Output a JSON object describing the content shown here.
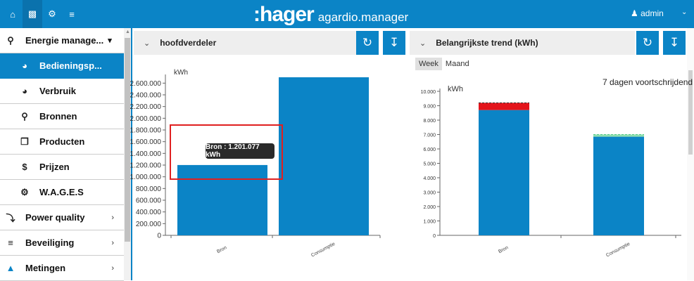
{
  "topbar": {
    "nav_icons": [
      "home-icon",
      "laptop-icon",
      "cogs-icon",
      "sliders-icon"
    ],
    "brand_logo": ":hager",
    "app_name": "agardio.manager",
    "user_icon": "user-icon",
    "user_name": "admin",
    "user_menu_icon": "chevron-down-icon"
  },
  "sidebar": {
    "items": [
      {
        "label": "Energie manage...",
        "icon": "lightbulb-icon",
        "chevron": "▾"
      },
      {
        "label": "Bedieningsp...",
        "icon": "pie-chart-icon"
      },
      {
        "label": "Verbruik",
        "icon": "gauge-icon"
      },
      {
        "label": "Bronnen",
        "icon": "lightbulb-icon"
      },
      {
        "label": "Producten",
        "icon": "cube-icon"
      },
      {
        "label": "Prijzen",
        "icon": "dollar-icon"
      },
      {
        "label": "W.A.G.E.S",
        "icon": "cogs-icon"
      },
      {
        "label": "Power quality",
        "icon": "plug-icon",
        "chevron": "›"
      },
      {
        "label": "Beveiliging",
        "icon": "sliders-icon",
        "chevron": "›"
      },
      {
        "label": "Metingen",
        "icon": "area-chart-icon",
        "chevron": "›"
      }
    ]
  },
  "left_panel": {
    "title": "hoofdverdeler",
    "refresh_icon": "refresh-icon",
    "export_icon": "download-icon",
    "tooltip": "Bron : 1.201.077 kWh"
  },
  "right_panel": {
    "title": "Belangrijkste trend (kWh)",
    "refresh_icon": "refresh-icon",
    "export_icon": "download-icon",
    "tabs": [
      "Week",
      "Maand"
    ],
    "selected_tab": "Week",
    "subtitle": "7 dagen voortschrijdend"
  },
  "colors": {
    "accent": "#0b84c6",
    "bar": "#0b84c6",
    "overflow": "#e3141b",
    "dashed": "#8fe0b0",
    "highlight": "#e02020"
  },
  "chart_data": [
    {
      "type": "bar",
      "categories": [
        "Bron",
        "Consumptie"
      ],
      "values": [
        1201077,
        2700000
      ],
      "ylabel": "kWh",
      "ylim": [
        0,
        2700000
      ],
      "yticks": [
        "0",
        "200.000",
        "400.000",
        "600.000",
        "800.000",
        "1.000.000",
        "1.200.000",
        "1.400.000",
        "1.600.000",
        "1.800.000",
        "2.000.000",
        "2.200.000",
        "2.400.000",
        "2.600.000"
      ],
      "grid": false
    },
    {
      "type": "bar",
      "categories": [
        "Bron",
        "Consumptie"
      ],
      "series": [
        {
          "values": [
            8700,
            6850
          ]
        },
        {
          "values": [
            500,
            0
          ]
        },
        {
          "values": [
            0,
            150
          ]
        }
      ],
      "ylabel": "kWh",
      "ylim": [
        0,
        10000
      ],
      "yticks": [
        "0",
        "1.000",
        "2.000",
        "3.000",
        "4.000",
        "5.000",
        "6.000",
        "7.000",
        "8.000",
        "9.000",
        "10.000"
      ],
      "grid": false
    }
  ]
}
